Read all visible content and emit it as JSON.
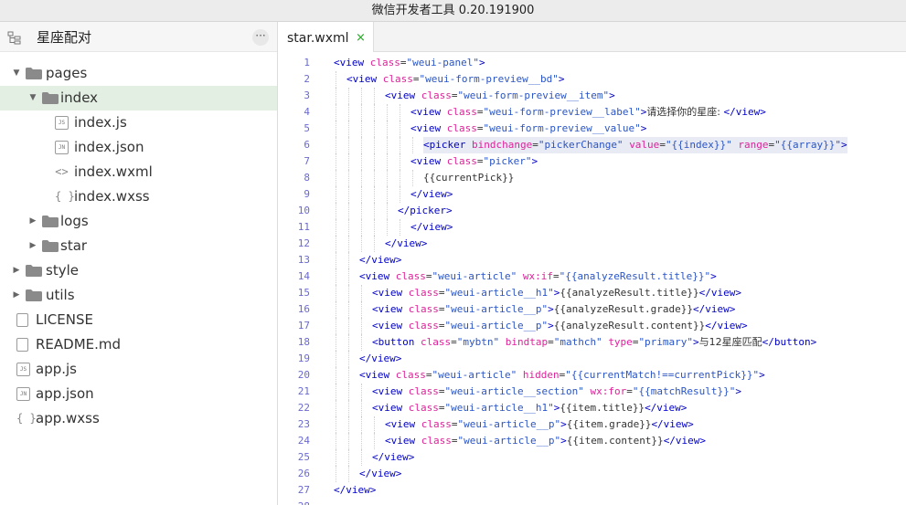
{
  "window": {
    "title": "微信开发者工具 0.20.191900"
  },
  "sidebar": {
    "project_name": "星座配对",
    "more_label": "···",
    "items": [
      {
        "label": "pages",
        "kind": "folder",
        "expanded": true,
        "depth": 0
      },
      {
        "label": "index",
        "kind": "folder",
        "expanded": true,
        "depth": 1,
        "selected": true
      },
      {
        "label": "index.js",
        "kind": "file",
        "badge": "JS",
        "depth": 2
      },
      {
        "label": "index.json",
        "kind": "file",
        "badge": "JN",
        "depth": 2
      },
      {
        "label": "index.wxml",
        "kind": "file",
        "badge": "<>",
        "depth": 2
      },
      {
        "label": "index.wxss",
        "kind": "file",
        "badge": "{ }",
        "depth": 2
      },
      {
        "label": "logs",
        "kind": "folder",
        "expanded": false,
        "depth": 1
      },
      {
        "label": "star",
        "kind": "folder",
        "expanded": false,
        "depth": 1
      },
      {
        "label": "style",
        "kind": "folder",
        "expanded": false,
        "depth": 0
      },
      {
        "label": "utils",
        "kind": "folder",
        "expanded": false,
        "depth": 0
      },
      {
        "label": "LICENSE",
        "kind": "file",
        "badge": "",
        "depth": 0
      },
      {
        "label": "README.md",
        "kind": "file",
        "badge": "",
        "depth": 0
      },
      {
        "label": "app.js",
        "kind": "file",
        "badge": "JS",
        "depth": 0
      },
      {
        "label": "app.json",
        "kind": "file",
        "badge": "JN",
        "depth": 0
      },
      {
        "label": "app.wxss",
        "kind": "file",
        "badge": "{ }",
        "depth": 0
      }
    ]
  },
  "editor": {
    "tab": {
      "label": "star.wxml",
      "close": "×"
    },
    "highlight_line": 6,
    "lines": [
      {
        "n": "1",
        "indent": 0,
        "tokens": [
          [
            "t",
            "<view "
          ],
          [
            "a",
            "class"
          ],
          [
            "e",
            "="
          ],
          [
            "s",
            "\"weui-panel\""
          ],
          [
            "t",
            ">"
          ]
        ]
      },
      {
        "n": "2",
        "indent": 1,
        "tokens": [
          [
            "t",
            "<view "
          ],
          [
            "a",
            "class"
          ],
          [
            "e",
            "="
          ],
          [
            "s",
            "\"weui-form-preview__bd\""
          ],
          [
            "t",
            ">"
          ]
        ]
      },
      {
        "n": "3",
        "indent": 4,
        "tokens": [
          [
            "t",
            "<view "
          ],
          [
            "a",
            "class"
          ],
          [
            "e",
            "="
          ],
          [
            "s",
            "\"weui-form-preview__item\""
          ],
          [
            "t",
            ">"
          ]
        ]
      },
      {
        "n": "4",
        "indent": 6,
        "tokens": [
          [
            "t",
            "<view "
          ],
          [
            "a",
            "class"
          ],
          [
            "e",
            "="
          ],
          [
            "s",
            "\"weui-form-preview__label\""
          ],
          [
            "t",
            ">"
          ],
          [
            "x",
            "请选择你的星座: "
          ],
          [
            "t",
            "</view>"
          ]
        ]
      },
      {
        "n": "5",
        "indent": 6,
        "tokens": [
          [
            "t",
            "<view "
          ],
          [
            "a",
            "class"
          ],
          [
            "e",
            "="
          ],
          [
            "s",
            "\"weui-form-preview__value\""
          ],
          [
            "t",
            ">"
          ]
        ]
      },
      {
        "n": "6",
        "indent": 7,
        "tokens": [
          [
            "t",
            "<picker "
          ],
          [
            "a",
            "bindchange"
          ],
          [
            "e",
            "="
          ],
          [
            "s",
            "\"pickerChange\""
          ],
          [
            "e",
            " "
          ],
          [
            "a",
            "value"
          ],
          [
            "e",
            "="
          ],
          [
            "s",
            "\"{{index}}\""
          ],
          [
            "e",
            " "
          ],
          [
            "a",
            "range"
          ],
          [
            "e",
            "="
          ],
          [
            "s",
            "\"{{array}}\""
          ],
          [
            "t",
            ">"
          ]
        ]
      },
      {
        "n": "7",
        "indent": 6,
        "tokens": [
          [
            "t",
            "<view "
          ],
          [
            "a",
            "class"
          ],
          [
            "e",
            "="
          ],
          [
            "s",
            "\"picker\""
          ],
          [
            "t",
            ">"
          ]
        ]
      },
      {
        "n": "8",
        "indent": 7,
        "tokens": [
          [
            "e",
            "{{currentPick}}"
          ]
        ]
      },
      {
        "n": "9",
        "indent": 6,
        "tokens": [
          [
            "t",
            "</view>"
          ]
        ]
      },
      {
        "n": "10",
        "indent": 5,
        "tokens": [
          [
            "t",
            "</picker>"
          ]
        ]
      },
      {
        "n": "11",
        "indent": 6,
        "tokens": [
          [
            "t",
            "</view>"
          ]
        ]
      },
      {
        "n": "12",
        "indent": 4,
        "tokens": [
          [
            "t",
            "</view>"
          ]
        ]
      },
      {
        "n": "13",
        "indent": 2,
        "tokens": [
          [
            "t",
            "</view>"
          ]
        ]
      },
      {
        "n": "14",
        "indent": 2,
        "tokens": [
          [
            "t",
            "<view "
          ],
          [
            "a",
            "class"
          ],
          [
            "e",
            "="
          ],
          [
            "s",
            "\"weui-article\""
          ],
          [
            "e",
            " "
          ],
          [
            "a",
            "wx:if"
          ],
          [
            "e",
            "="
          ],
          [
            "s",
            "\"{{analyzeResult.title}}\""
          ],
          [
            "t",
            ">"
          ]
        ]
      },
      {
        "n": "15",
        "indent": 3,
        "tokens": [
          [
            "t",
            "<view "
          ],
          [
            "a",
            "class"
          ],
          [
            "e",
            "="
          ],
          [
            "s",
            "\"weui-article__h1\""
          ],
          [
            "t",
            ">"
          ],
          [
            "e",
            "{{analyzeResult.title}}"
          ],
          [
            "t",
            "</view>"
          ]
        ]
      },
      {
        "n": "16",
        "indent": 3,
        "tokens": [
          [
            "t",
            "<view "
          ],
          [
            "a",
            "class"
          ],
          [
            "e",
            "="
          ],
          [
            "s",
            "\"weui-article__p\""
          ],
          [
            "t",
            ">"
          ],
          [
            "e",
            "{{analyzeResult.grade}}"
          ],
          [
            "t",
            "</view>"
          ]
        ]
      },
      {
        "n": "17",
        "indent": 3,
        "tokens": [
          [
            "t",
            "<view "
          ],
          [
            "a",
            "class"
          ],
          [
            "e",
            "="
          ],
          [
            "s",
            "\"weui-article__p\""
          ],
          [
            "t",
            ">"
          ],
          [
            "e",
            "{{analyzeResult.content}}"
          ],
          [
            "t",
            "</view>"
          ]
        ]
      },
      {
        "n": "18",
        "indent": 3,
        "tokens": [
          [
            "t",
            "<button "
          ],
          [
            "a",
            "class"
          ],
          [
            "e",
            "="
          ],
          [
            "s",
            "\"mybtn\""
          ],
          [
            "e",
            " "
          ],
          [
            "a",
            "bindtap"
          ],
          [
            "e",
            "="
          ],
          [
            "s",
            "\"mathch\""
          ],
          [
            "e",
            " "
          ],
          [
            "a",
            "type"
          ],
          [
            "e",
            "="
          ],
          [
            "s",
            "\"primary\""
          ],
          [
            "t",
            ">"
          ],
          [
            "x",
            "与12星座匹配"
          ],
          [
            "t",
            "</button>"
          ]
        ]
      },
      {
        "n": "19",
        "indent": 2,
        "tokens": [
          [
            "t",
            "</view>"
          ]
        ]
      },
      {
        "n": "20",
        "indent": 2,
        "tokens": [
          [
            "t",
            "<view "
          ],
          [
            "a",
            "class"
          ],
          [
            "e",
            "="
          ],
          [
            "s",
            "\"weui-article\""
          ],
          [
            "e",
            " "
          ],
          [
            "a",
            "hidden"
          ],
          [
            "e",
            "="
          ],
          [
            "s",
            "\"{{currentMatch!==currentPick}}\""
          ],
          [
            "t",
            ">"
          ]
        ]
      },
      {
        "n": "21",
        "indent": 3,
        "tokens": [
          [
            "t",
            "<view "
          ],
          [
            "a",
            "class"
          ],
          [
            "e",
            "="
          ],
          [
            "s",
            "\"weui-article__section\""
          ],
          [
            "e",
            " "
          ],
          [
            "a",
            "wx:for"
          ],
          [
            "e",
            "="
          ],
          [
            "s",
            "\"{{matchResult}}\""
          ],
          [
            "t",
            ">"
          ]
        ]
      },
      {
        "n": "22",
        "indent": 3,
        "tokens": [
          [
            "t",
            "<view "
          ],
          [
            "a",
            "class"
          ],
          [
            "e",
            "="
          ],
          [
            "s",
            "\"weui-article__h1\""
          ],
          [
            "t",
            ">"
          ],
          [
            "e",
            "{{item.title}}"
          ],
          [
            "t",
            "</view>"
          ]
        ]
      },
      {
        "n": "23",
        "indent": 4,
        "tokens": [
          [
            "t",
            "<view "
          ],
          [
            "a",
            "class"
          ],
          [
            "e",
            "="
          ],
          [
            "s",
            "\"weui-article__p\""
          ],
          [
            "t",
            ">"
          ],
          [
            "e",
            "{{item.grade}}"
          ],
          [
            "t",
            "</view>"
          ]
        ]
      },
      {
        "n": "24",
        "indent": 4,
        "tokens": [
          [
            "t",
            "<view "
          ],
          [
            "a",
            "class"
          ],
          [
            "e",
            "="
          ],
          [
            "s",
            "\"weui-article__p\""
          ],
          [
            "t",
            ">"
          ],
          [
            "e",
            "{{item.content}}"
          ],
          [
            "t",
            "</view>"
          ]
        ]
      },
      {
        "n": "25",
        "indent": 3,
        "tokens": [
          [
            "t",
            "</view>"
          ]
        ]
      },
      {
        "n": "26",
        "indent": 2,
        "tokens": [
          [
            "t",
            "</view>"
          ]
        ]
      },
      {
        "n": "27",
        "indent": 0,
        "tokens": [
          [
            "t",
            "</view>"
          ]
        ]
      },
      {
        "n": "28",
        "indent": 0,
        "tokens": []
      }
    ]
  },
  "colors": {
    "accent": "#1aad19",
    "selection": "#e4efe4",
    "tag": "#0000c8",
    "attr": "#e0209b",
    "string": "#2a55c6",
    "line_number": "#6a6ad0"
  }
}
